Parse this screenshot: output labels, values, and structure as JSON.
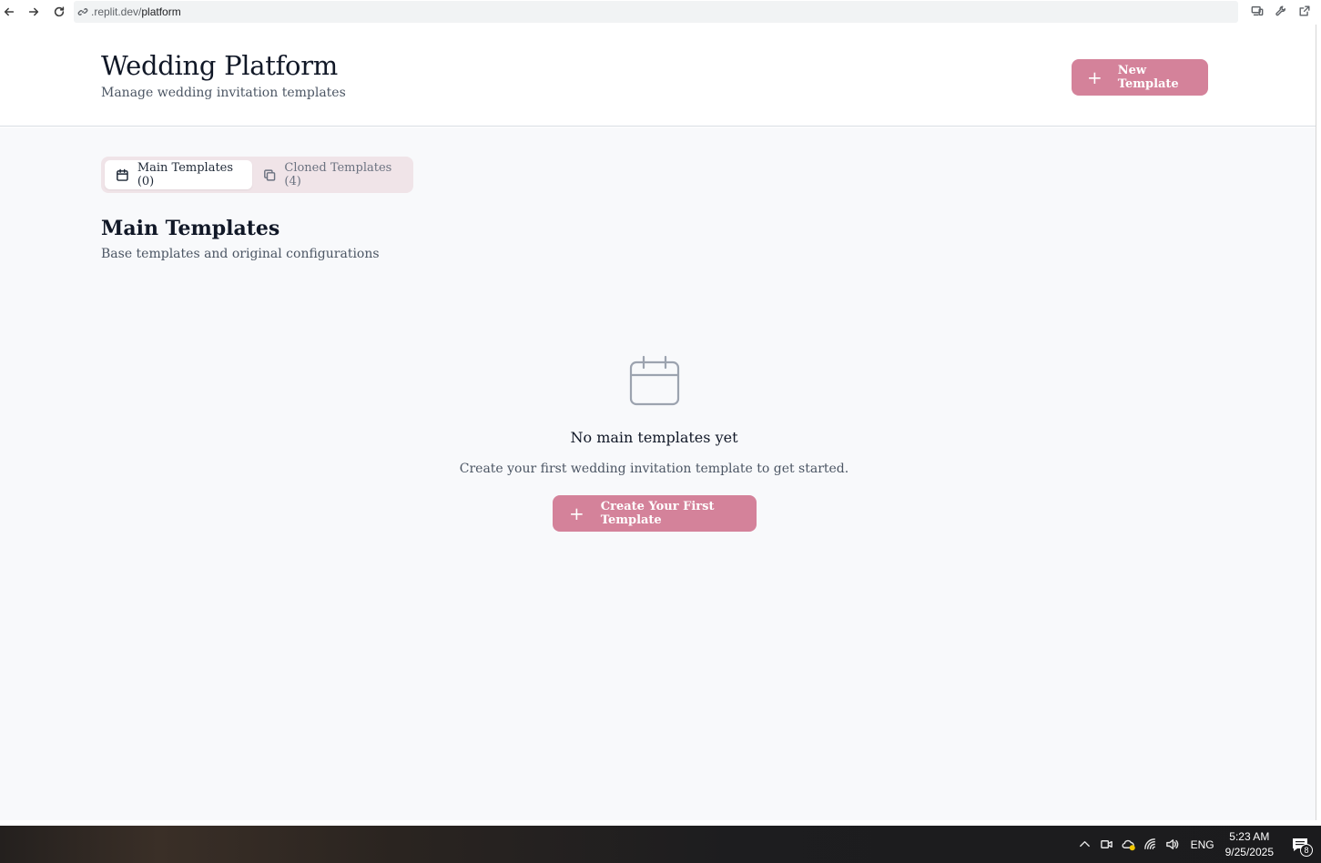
{
  "browser": {
    "url_prefix": ".replit.dev/",
    "url_path": "platform"
  },
  "header": {
    "title": "Wedding Platform",
    "subtitle": "Manage wedding invitation templates",
    "new_button_label": "New Template"
  },
  "tabs": [
    {
      "label": "Main Templates (0)",
      "icon": "calendar-icon",
      "active": true
    },
    {
      "label": "Cloned Templates (4)",
      "icon": "copy-icon",
      "active": false
    }
  ],
  "section": {
    "title": "Main Templates",
    "subtitle": "Base templates and original configurations"
  },
  "empty_state": {
    "icon": "calendar-icon",
    "title": "No main templates yet",
    "description": "Create your first wedding invitation template to get started.",
    "button_label": "Create Your First Template"
  },
  "taskbar": {
    "language": "ENG",
    "time": "5:23 AM",
    "date": "9/25/2025",
    "notification_count": "8"
  },
  "colors": {
    "accent": "#d4829a",
    "tab_track": "#f0e4e8",
    "main_bg": "#f8f9fb"
  }
}
